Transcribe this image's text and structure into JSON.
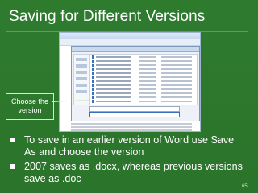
{
  "slide": {
    "title": "Saving for Different Versions",
    "callout": "Choose the version",
    "bullets": [
      "To save in an earlier version of Word use Save As and choose the version",
      "2007 saves as .docx, whereas previous versions save as .doc"
    ],
    "page_number": "65"
  },
  "colors": {
    "background": "#2e7b2e",
    "text": "#ffffff",
    "accent_line": "#5aa05a"
  },
  "icons": {
    "bullet": "square-bullet-icon",
    "file": "word-file-icon"
  },
  "screenshot": {
    "file_rows": 12
  }
}
